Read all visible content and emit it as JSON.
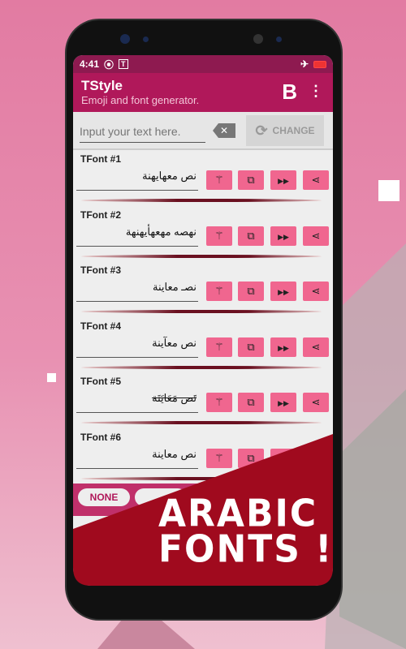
{
  "status": {
    "time": "4:41",
    "icons": [
      "record-icon",
      "tstyle-icon",
      "airplane-icon",
      "battery-icon"
    ]
  },
  "appbar": {
    "title": "TStyle",
    "subtitle": "Emoji and font generator.",
    "bold_label": "B",
    "menu_icon": "more-vert-icon"
  },
  "input": {
    "placeholder": "Input your text here.",
    "value": "",
    "change_label": "CHANGE"
  },
  "fonts": [
    {
      "label": "TFont #1",
      "preview": "نص معهايهنة"
    },
    {
      "label": "TFont #2",
      "preview": "نهصه مهعهأيهنهة"
    },
    {
      "label": "TFont #3",
      "preview": "نصـ معاينة"
    },
    {
      "label": "TFont #4",
      "preview": "نص معآينة"
    },
    {
      "label": "TFont #5",
      "preview": "تَص مَعَايَنَة"
    },
    {
      "label": "TFont #6",
      "preview": "نص معاينة"
    }
  ],
  "row_actions": [
    "magic-wand-icon",
    "copy-icon",
    "send-icon",
    "share-icon"
  ],
  "bottom": {
    "chip": "NONE"
  },
  "banner": {
    "line1": "ARABIC",
    "line2": "FONTS !"
  },
  "colors": {
    "primary": "#b0185a",
    "status": "#8e1a50",
    "button": "#f0668f",
    "banner": "#a00a1e"
  }
}
